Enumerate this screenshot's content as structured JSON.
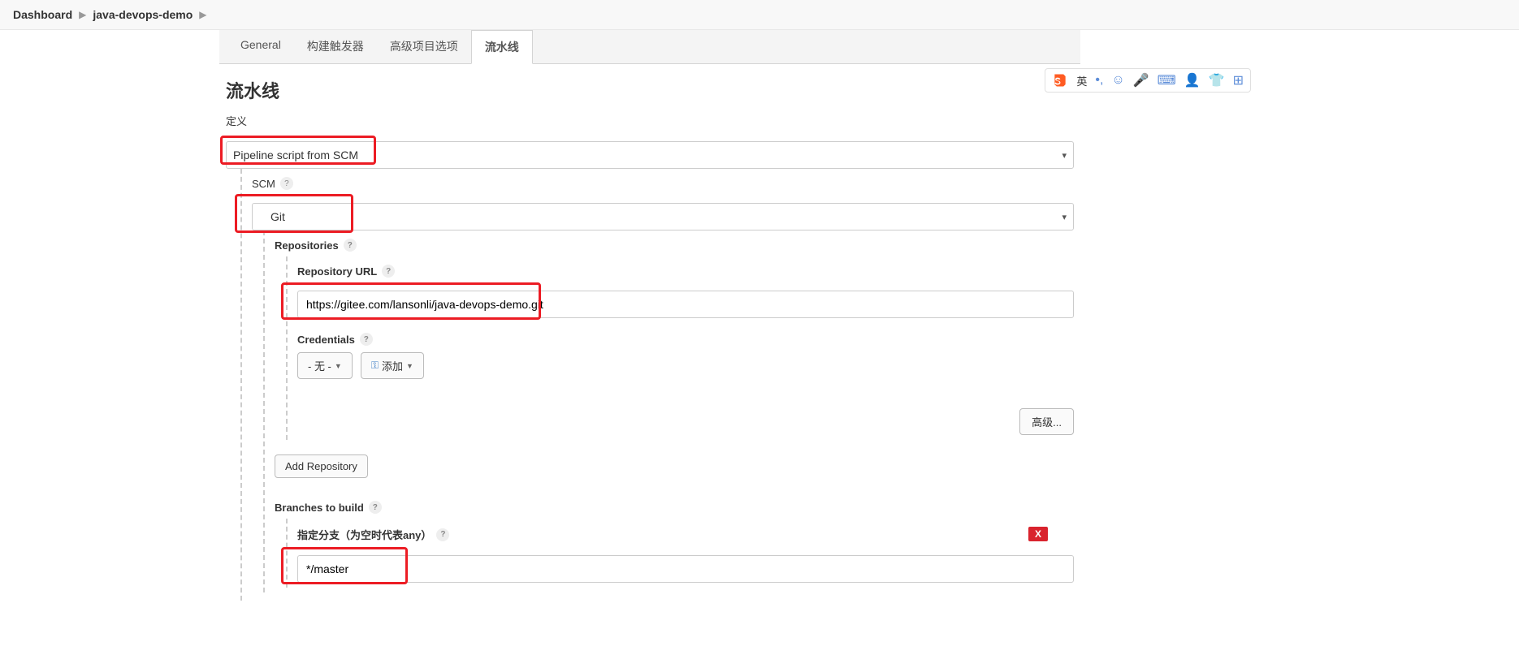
{
  "breadcrumb": {
    "dashboard": "Dashboard",
    "project": "java-devops-demo"
  },
  "tabs": {
    "general": "General",
    "triggers": "构建触发器",
    "advanced": "高级项目选项",
    "pipeline": "流水线"
  },
  "section": {
    "title": "流水线",
    "definition_label": "定义",
    "definition_value": "Pipeline script from SCM",
    "scm_label": "SCM",
    "scm_value": "Git",
    "repositories_label": "Repositories",
    "repo_url_label": "Repository URL",
    "repo_url_value": "https://gitee.com/lansonli/java-devops-demo.git",
    "credentials_label": "Credentials",
    "credentials_none": "- 无 -",
    "credentials_add": "添加",
    "advanced_btn": "高级...",
    "add_repo_btn": "Add Repository",
    "branches_label": "Branches to build",
    "branch_specifier_label": "指定分支（为空时代表any）",
    "branch_specifier_value": "*/master",
    "delete_x": "X"
  },
  "ime": {
    "lang": "英"
  }
}
